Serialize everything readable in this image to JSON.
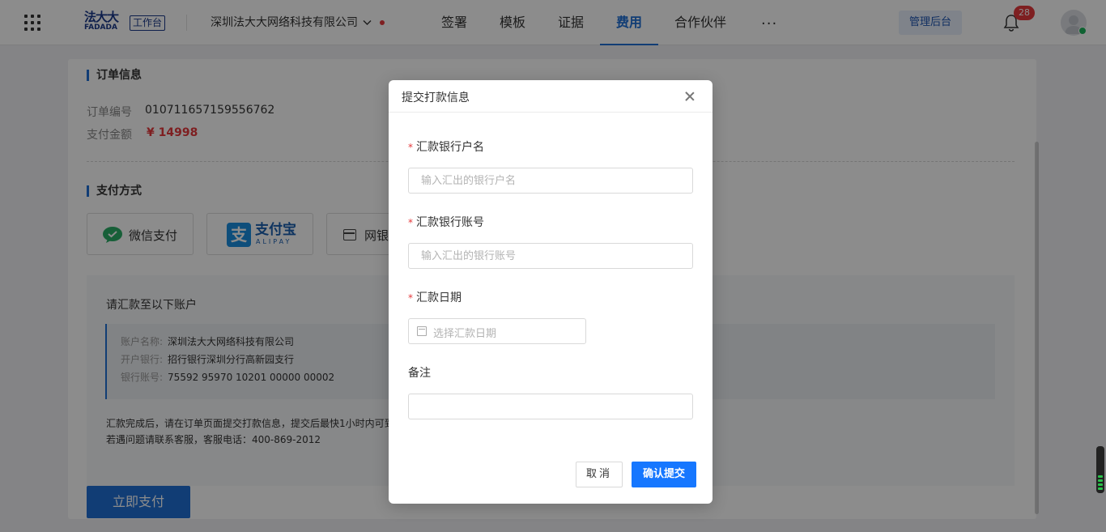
{
  "topbar": {
    "logo_cn": "法大大",
    "logo_en": "FADADA",
    "workspace_badge": "工作台",
    "company": "深圳法大大网络科技有限公司",
    "nav": [
      {
        "label": "签署"
      },
      {
        "label": "模板"
      },
      {
        "label": "证据"
      },
      {
        "label": "费用"
      },
      {
        "label": "合作伙伴"
      }
    ],
    "active_nav": "费用",
    "more": "···",
    "admin_label": "管理后台",
    "notification_count": "28"
  },
  "order": {
    "section_title": "订单信息",
    "number_label": "订单编号",
    "number_value": "010711657159556762",
    "amount_label": "支付金额",
    "amount_value": "¥ 14998"
  },
  "payment": {
    "section_title": "支付方式",
    "methods": [
      {
        "label": "微信支付"
      },
      {
        "label": "支付宝",
        "sub": "ALIPAY"
      },
      {
        "label": "网银"
      }
    ],
    "transfer_title": "请汇款至以下账户",
    "account": {
      "name_label": "账户名称:",
      "name_value": "深圳法大大网络科技有限公司",
      "bank_label": "开户银行:",
      "bank_value": "招行银行深圳分行高新园支行",
      "number_label": "银行账号:",
      "number_value": "75592 95970 10201 00000 00002"
    },
    "notice_line1": "汇款完成后，请在订单页面提交打款信息，提交后最快1小时内可到",
    "notice_line2": "若遇问题请联系客服，客服电话：400-869-2012",
    "pay_button": "立即支付"
  },
  "modal": {
    "title": "提交打款信息",
    "required_mark": "*",
    "fields": {
      "bank_account_name": {
        "label": "汇款银行户名",
        "placeholder": "输入汇出的银行户名"
      },
      "bank_account_number": {
        "label": "汇款银行账号",
        "placeholder": "输入汇出的银行账号"
      },
      "remit_date": {
        "label": "汇款日期",
        "placeholder": "选择汇款日期"
      },
      "remark": {
        "label": "备注",
        "placeholder": ""
      }
    },
    "cancel_label": "取消",
    "confirm_label": "确认提交"
  },
  "colors": {
    "primary": "#1f6fd6",
    "confirm": "#1677ff",
    "danger": "#e5393c",
    "brand": "#1a3a8a"
  },
  "icons": [
    "apps-grid-icon",
    "chevron-down-icon",
    "bell-icon",
    "avatar-icon",
    "wechat-pay-icon",
    "alipay-icon",
    "bank-card-icon",
    "close-icon",
    "calendar-icon"
  ]
}
